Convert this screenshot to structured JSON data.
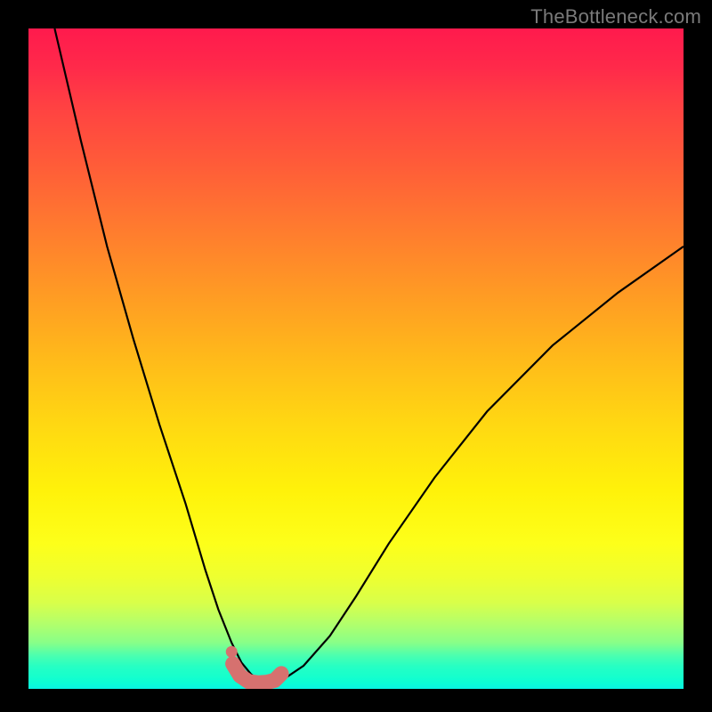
{
  "watermark": "TheBottleneck.com",
  "colors": {
    "frame": "#000000",
    "curve": "#000000",
    "marker": "#d6716f",
    "gradient_stops": [
      "#ff1a4d",
      "#ff2a4a",
      "#ff4242",
      "#ff5a39",
      "#ff7a2f",
      "#ff9a24",
      "#ffba1a",
      "#ffd812",
      "#fff20a",
      "#fdff1a",
      "#eeff30",
      "#d8ff4a",
      "#b4ff6a",
      "#88ff88",
      "#4affb0",
      "#28ffc2",
      "#1effc8",
      "#1affca",
      "#14ffce",
      "#0cfdd4",
      "#0af7de",
      "#0af2e6"
    ]
  },
  "chart_data": {
    "type": "line",
    "title": "",
    "xlabel": "",
    "ylabel": "",
    "xlim": [
      0,
      100
    ],
    "ylim": [
      0,
      100
    ],
    "grid": false,
    "series": [
      {
        "name": "bottleneck-curve",
        "x": [
          4,
          8,
          12,
          16,
          20,
          24,
          27,
          29,
          31,
          32.5,
          34,
          35.5,
          37,
          39,
          42,
          46,
          50,
          55,
          62,
          70,
          80,
          90,
          100
        ],
        "y": [
          100,
          83,
          67,
          53,
          40,
          28,
          18,
          12,
          7,
          4,
          2.2,
          1.2,
          1.0,
          1.5,
          3.5,
          8,
          14,
          22,
          32,
          42,
          52,
          60,
          67
        ]
      }
    ],
    "markers": {
      "name": "highlight-trough",
      "shape": "rounded",
      "x": [
        31.2,
        32.3,
        33.6,
        35.0,
        36.4,
        37.6,
        38.6
      ],
      "y": [
        3.8,
        2.0,
        1.1,
        0.9,
        1.0,
        1.3,
        2.3
      ],
      "end_dot": {
        "x": 31.0,
        "y": 5.6
      }
    }
  }
}
